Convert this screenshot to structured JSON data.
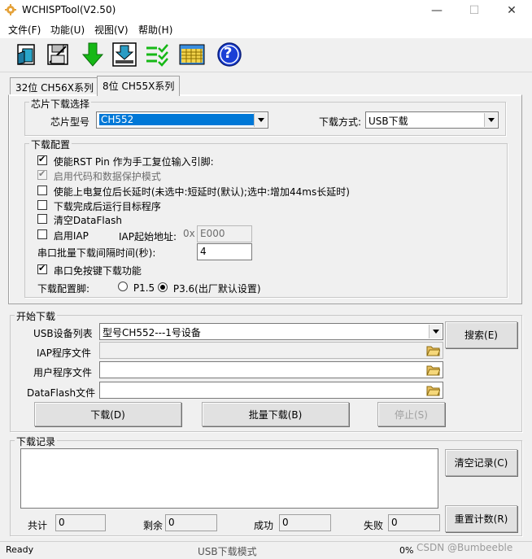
{
  "window": {
    "title": "WCHISPTool(V2.50)",
    "controls": {
      "minimize": "—",
      "maximize": "☐",
      "close": "✕"
    }
  },
  "menu": [
    "文件(F)",
    "功能(U)",
    "视图(V)",
    "帮助(H)"
  ],
  "toolbar": {
    "icons": [
      "open-file-icon",
      "save-file-icon",
      "download-arrow-icon",
      "chip-program-icon",
      "batch-verify-icon",
      "chip-grid-icon",
      "help-icon"
    ],
    "help_glyph": "?"
  },
  "tabs": [
    {
      "label": "32位 CH56X系列",
      "active": false
    },
    {
      "label": "8位 CH55X系列",
      "active": true
    }
  ],
  "chip_select": {
    "group_title": "芯片下载选择",
    "model_label": "芯片型号",
    "model_value": "CH552",
    "method_label": "下载方式:",
    "method_value": "USB下载"
  },
  "download_config": {
    "group_title": "下载配置",
    "options": [
      {
        "label": "使能RST Pin 作为手工复位输入引脚:",
        "checked": true,
        "disabled": false
      },
      {
        "label": "启用代码和数据保护模式",
        "checked": true,
        "disabled": true
      },
      {
        "label": "使能上电复位后长延时(未选中:短延时(默认);选中:增加44ms长延时)",
        "checked": false,
        "disabled": false
      },
      {
        "label": "下载完成后运行目标程序",
        "checked": false,
        "disabled": false
      },
      {
        "label": "清空DataFlash",
        "checked": false,
        "disabled": false
      }
    ],
    "iap_label": "启用IAP",
    "iap_checked": false,
    "iap_addr_label": "IAP起始地址:",
    "iap_addr_prefix": "0x",
    "iap_addr_value": "E000",
    "batch_interval_label": "串口批量下载间隔时间(秒):",
    "batch_interval_value": "4",
    "serial_nokey_label": "串口免按键下载功能",
    "serial_nokey_checked": true,
    "pin_label": "下载配置脚:",
    "pin_options": [
      {
        "label": "P1.5",
        "selected": false
      },
      {
        "label": "P3.6(出厂默认设置)",
        "selected": true
      }
    ]
  },
  "start_download": {
    "group_title": "开始下载",
    "usb_list_label": "USB设备列表",
    "usb_list_value": "型号CH552---1号设备",
    "search_button": "搜索(E)",
    "iap_file_label": "IAP程序文件",
    "iap_file_value": "",
    "user_file_label": "用户程序文件",
    "user_file_value": "",
    "dataflash_file_label": "DataFlash文件",
    "dataflash_file_value": "",
    "download_button": "下载(D)",
    "batch_download_button": "批量下载(B)",
    "stop_button": "停止(S)"
  },
  "log": {
    "group_title": "下载记录",
    "clear_button": "清空记录(C)",
    "reset_count_button": "重置计数(R)",
    "total_label": "共计",
    "total_value": "0",
    "remain_label": "剩余",
    "remain_value": "0",
    "success_label": "成功",
    "success_value": "0",
    "fail_label": "失败",
    "fail_value": "0"
  },
  "status": {
    "ready": "Ready",
    "mode": "USB下载模式",
    "progress": "0%",
    "watermark": "CSDN @Bumbeeble"
  },
  "colors": {
    "selection": "#0078d7",
    "help_blue": "#1a3fd6",
    "arrow_green": "#16b816"
  }
}
